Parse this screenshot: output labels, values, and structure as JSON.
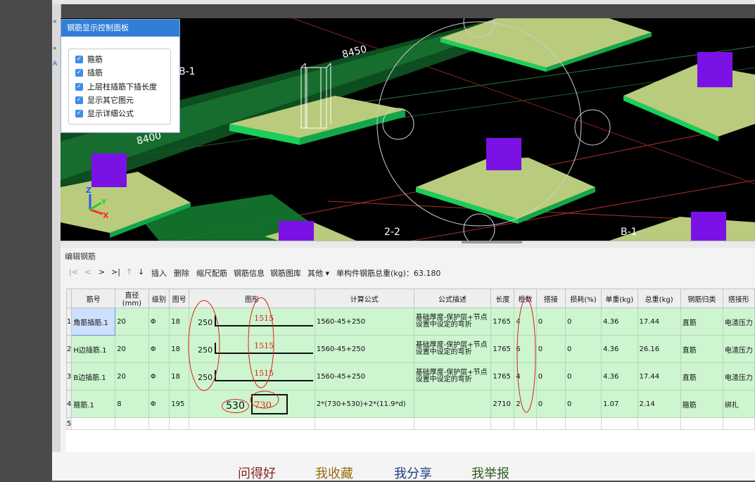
{
  "control_panel": {
    "title": "钢筋显示控制面板",
    "options": [
      {
        "label": "箍筋",
        "checked": true
      },
      {
        "label": "插筋",
        "checked": true
      },
      {
        "label": "上层柱插筋下插长度",
        "checked": true
      },
      {
        "label": "显示其它图元",
        "checked": true
      },
      {
        "label": "显示详细公式",
        "checked": true
      }
    ]
  },
  "viewport": {
    "dim_8450": "8450",
    "dim_8400": "8400",
    "axis_b1_left": "B-1",
    "axis_b1_right": "B-1",
    "axis_22": "2-2",
    "axis_x": "X",
    "axis_y": "Y",
    "axis_z": "Z"
  },
  "editor": {
    "title": "编辑钢筋",
    "toolbar": {
      "first": "|<",
      "prev": "<",
      "next": ">",
      "last": ">|",
      "up": "↑",
      "down": "↓",
      "insert": "插入",
      "delete": "删除",
      "scale_rebar": "缩尺配筋",
      "rebar_info": "钢筋信息",
      "rebar_library": "钢筋图库",
      "other": "其他 ▾",
      "total_weight": "单构件钢筋总重(kg)：63.180"
    },
    "columns": [
      "筋号",
      "直径(mm)",
      "级别",
      "图号",
      "图形",
      "计算公式",
      "公式描述",
      "长度",
      "根数",
      "搭接",
      "损耗(%)",
      "单重(kg)",
      "总重(kg)",
      "钢筋归类",
      "搭接形"
    ],
    "rows": [
      {
        "num": "1",
        "name": "角筋插筋.1",
        "dia": "20",
        "grade": "Φ",
        "fig": "18",
        "shape_a": "250",
        "shape_b": "1515",
        "formula": "1560-45+250",
        "desc": "基础厚度-保护层+节点设置中设定的弯折",
        "len": "1765",
        "count": "4",
        "lap": "0",
        "loss": "0",
        "unit_w": "4.36",
        "total_w": "17.44",
        "category": "直筋",
        "lap_type": "电渣压力"
      },
      {
        "num": "2",
        "name": "H边插筋.1",
        "dia": "20",
        "grade": "Φ",
        "fig": "18",
        "shape_a": "250",
        "shape_b": "1515",
        "formula": "1560-45+250",
        "desc": "基础厚度-保护层+节点设置中设定的弯折",
        "len": "1765",
        "count": "6",
        "lap": "0",
        "loss": "0",
        "unit_w": "4.36",
        "total_w": "26.16",
        "category": "直筋",
        "lap_type": "电渣压力"
      },
      {
        "num": "3",
        "name": "B边插筋.1",
        "dia": "20",
        "grade": "Φ",
        "fig": "18",
        "shape_a": "250",
        "shape_b": "1515",
        "formula": "1560-45+250",
        "desc": "基础厚度-保护层+节点设置中设定的弯折",
        "len": "1765",
        "count": "4",
        "lap": "0",
        "loss": "0",
        "unit_w": "4.36",
        "total_w": "17.44",
        "category": "直筋",
        "lap_type": "电渣压力"
      },
      {
        "num": "4",
        "name": "箍筋.1",
        "dia": "8",
        "grade": "Φ",
        "fig": "195",
        "shape_a": "530",
        "shape_b": "730",
        "formula": "2*(730+530)+2*(11.9*d)",
        "desc": "",
        "len": "2710",
        "count": "2",
        "lap": "0",
        "loss": "0",
        "unit_w": "1.07",
        "total_w": "2.14",
        "category": "箍筋",
        "lap_type": "绑扎"
      }
    ],
    "empty_row_num": "5"
  },
  "bottom_links": [
    "问得好",
    "我收藏",
    "我分享",
    "我举报"
  ],
  "colors": {
    "panel_header": "#2f7fd9",
    "row_bg": "#ccf5d0",
    "annotation": "#e0201a",
    "column_violet": "#7a12e6",
    "footing": "#b9cb7d",
    "footing_edge": "#19d05a"
  }
}
